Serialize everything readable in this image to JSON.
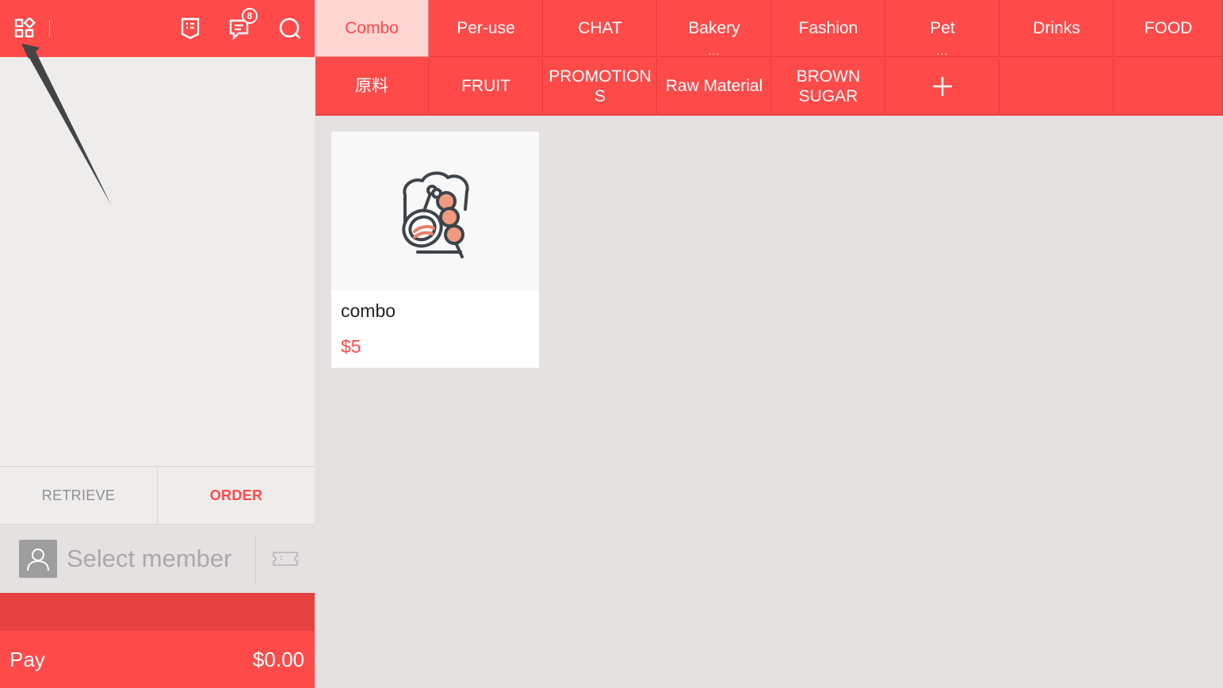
{
  "topbar": {
    "icons": [
      "apps-grid-icon",
      "order-list-icon",
      "message-icon",
      "search-icon"
    ],
    "message_badge": "8"
  },
  "categories": [
    {
      "label": "Combo",
      "active": true
    },
    {
      "label": "Per-use"
    },
    {
      "label": "CHAT"
    },
    {
      "label": "Bakery",
      "more": "..."
    },
    {
      "label": "Fashion"
    },
    {
      "label": "Pet",
      "more": "..."
    },
    {
      "label": "Drinks"
    },
    {
      "label": "FOOD"
    },
    {
      "label": "原料"
    },
    {
      "label": "FRUIT"
    },
    {
      "label": "PROMOTION\nS"
    },
    {
      "label": "Raw Material"
    },
    {
      "label": "BROWN\nSUGAR"
    },
    {
      "label": "+",
      "icon": "add-icon"
    }
  ],
  "products": [
    {
      "name": "combo",
      "price": "$5",
      "icon": "food-combo-icon"
    }
  ],
  "actions": {
    "retrieve": "RETRIEVE",
    "order": "ORDER"
  },
  "member": {
    "placeholder": "Select member"
  },
  "pay": {
    "label": "Pay",
    "amount": "$0.00"
  },
  "colors": {
    "brand": "#ff4a4a",
    "active_tab_bg": "#ffd5d2",
    "panel_bg": "#efedec",
    "content_bg": "#e4e1e0"
  }
}
